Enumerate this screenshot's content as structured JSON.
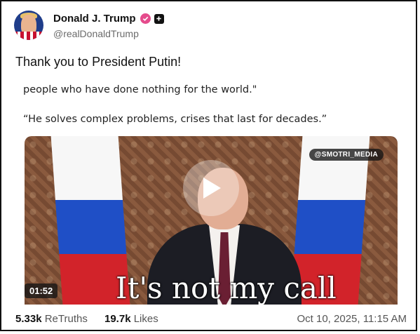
{
  "author": {
    "display_name": "Donald J. Trump",
    "handle": "@realDonaldTrump"
  },
  "post": {
    "text": "Thank you to President Putin!"
  },
  "media": {
    "quote_line_1": "people who have done nothing for the world.\"",
    "quote_line_2": "“He solves complex problems, crises that last for decades.”",
    "watermark": "@SMOTRI_MEDIA",
    "duration": "01:52",
    "caption": "It's not my call"
  },
  "stats": {
    "retruths_count": "5.33k",
    "retruths_label": "ReTruths",
    "likes_count": "19.7k",
    "likes_label": "Likes",
    "timestamp": "Oct 10, 2025, 11:15 AM"
  },
  "colors": {
    "verified_badge": "#e54b8c",
    "text_primary": "#111111",
    "text_secondary": "#6b6b6b"
  },
  "icons": [
    "verified-icon",
    "plus-icon",
    "play-icon"
  ]
}
